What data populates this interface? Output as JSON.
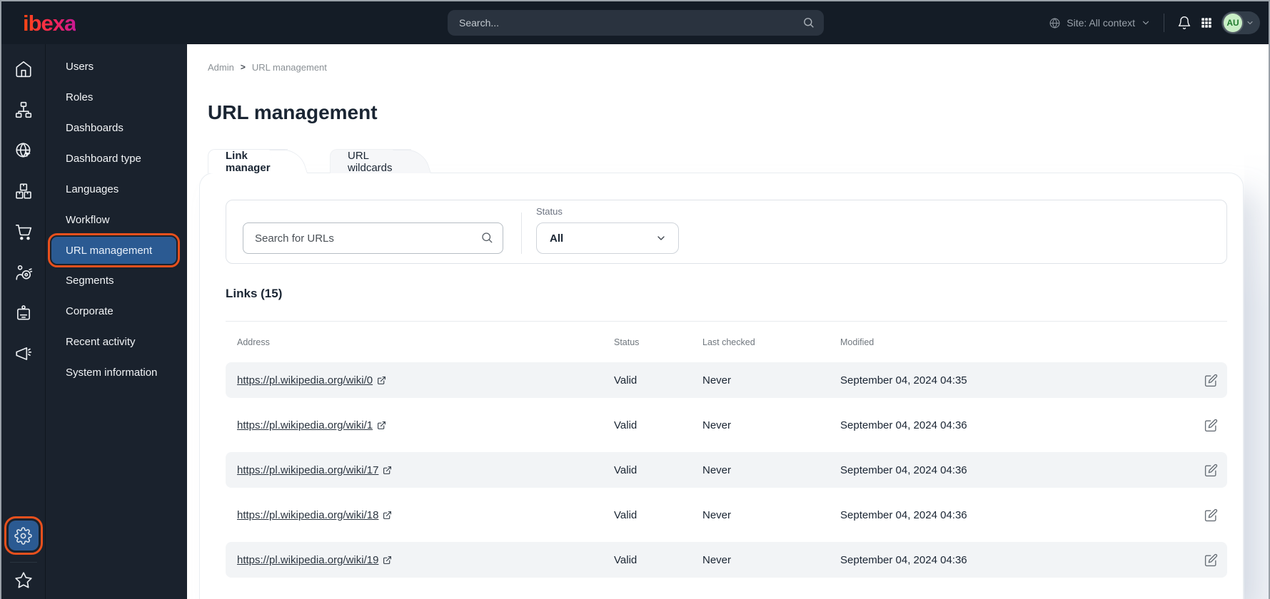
{
  "topbar": {
    "logo_text": "ibexa",
    "search_placeholder": "Search...",
    "site_context_label": "Site: All context",
    "avatar_initials": "AU"
  },
  "icons": {
    "rail": [
      "home-icon",
      "content-structure-icon",
      "site-icon",
      "product-catalog-icon",
      "commerce-cart-icon",
      "personalization-target-icon",
      "corporate-badge-icon",
      "marketing-megaphone-icon",
      "settings-gear-icon",
      "favorites-star-icon"
    ],
    "topbar": [
      "globe-icon",
      "chevron-down-icon",
      "bell-icon",
      "app-grid-icon",
      "search-icon"
    ],
    "table": [
      "external-link-icon",
      "edit-icon"
    ]
  },
  "sidebar": {
    "items": [
      "Users",
      "Roles",
      "Dashboards",
      "Dashboard type",
      "Languages",
      "Workflow",
      "URL management",
      "Segments",
      "Corporate",
      "Recent activity",
      "System information"
    ],
    "selected": "URL management"
  },
  "main": {
    "breadcrumb": {
      "items": [
        "Admin",
        "URL management"
      ],
      "separator": ">"
    },
    "title": "URL management",
    "tabs": [
      {
        "label": "Link manager",
        "active": true
      },
      {
        "label": "URL wildcards",
        "active": false
      }
    ],
    "filters": {
      "search_placeholder": "Search for URLs",
      "status_label": "Status",
      "status_value": "All"
    },
    "links_heading": "Links (15)",
    "table": {
      "columns": [
        "Address",
        "Status",
        "Last checked",
        "Modified"
      ],
      "rows": [
        {
          "address": "https://pl.wikipedia.org/wiki/0",
          "status": "Valid",
          "last_checked": "Never",
          "modified": "September 04, 2024 04:35"
        },
        {
          "address": "https://pl.wikipedia.org/wiki/1",
          "status": "Valid",
          "last_checked": "Never",
          "modified": "September 04, 2024 04:36"
        },
        {
          "address": "https://pl.wikipedia.org/wiki/17",
          "status": "Valid",
          "last_checked": "Never",
          "modified": "September 04, 2024 04:36"
        },
        {
          "address": "https://pl.wikipedia.org/wiki/18",
          "status": "Valid",
          "last_checked": "Never",
          "modified": "September 04, 2024 04:36"
        },
        {
          "address": "https://pl.wikipedia.org/wiki/19",
          "status": "Valid",
          "last_checked": "Never",
          "modified": "September 04, 2024 04:36"
        }
      ]
    }
  },
  "colors": {
    "highlight_annotation": "#e8501d",
    "selected_blue": "#2b5a92",
    "topbar_bg": "#141c26",
    "avatar_green_bg": "#c9eec6",
    "avatar_green_text": "#1f7a2d"
  }
}
